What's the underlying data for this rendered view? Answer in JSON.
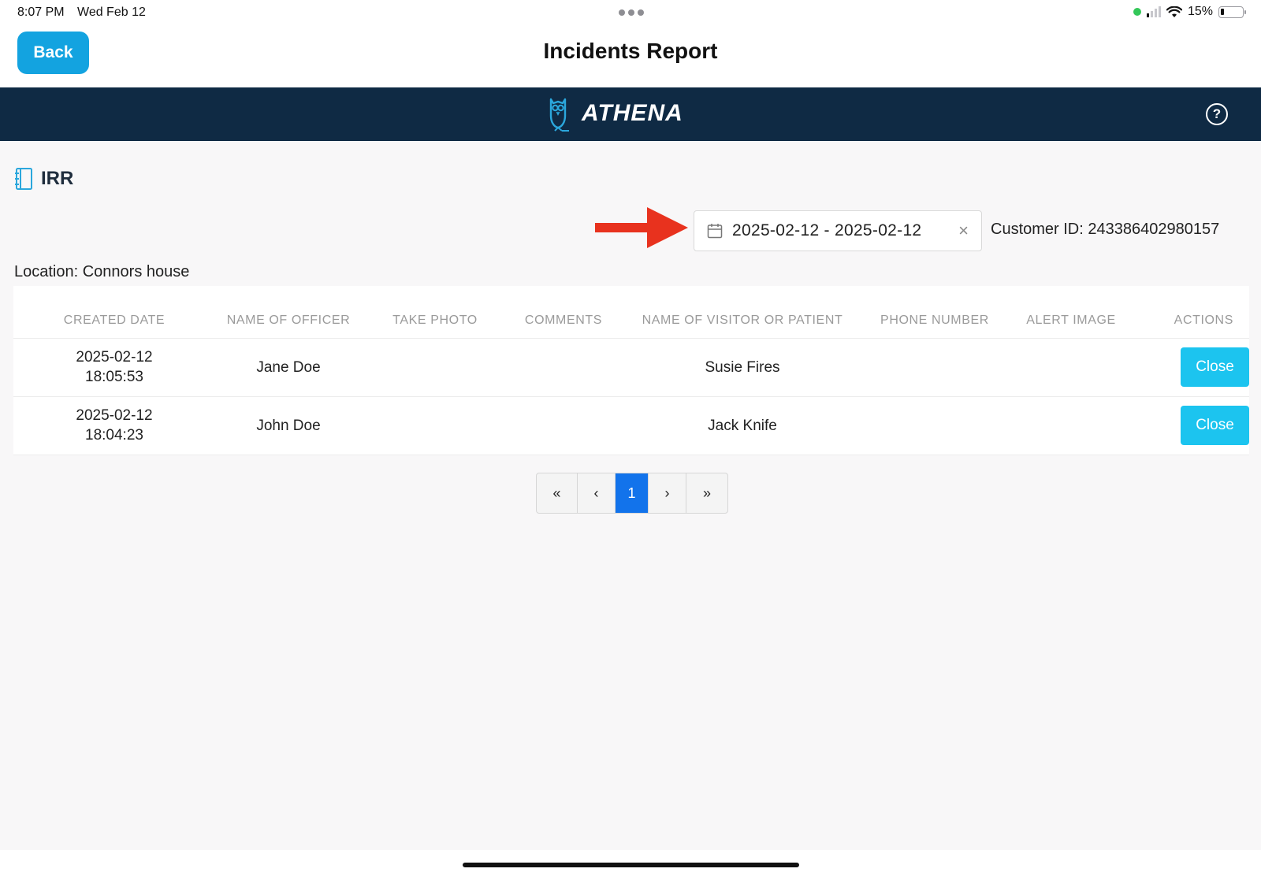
{
  "status_bar": {
    "time": "8:07 PM",
    "date": "Wed Feb 12",
    "battery_percent": "15%",
    "battery_level": 0.15,
    "icons": [
      "green-dot",
      "cellular-signal-icon",
      "wifi-icon",
      "battery-icon"
    ]
  },
  "nav": {
    "back_label": "Back",
    "title": "Incidents Report"
  },
  "brand": {
    "name": "ATHENA",
    "logo_icon": "owl-icon",
    "help_icon": "?",
    "bg_color": "#0f2a44"
  },
  "section": {
    "title": "IRR",
    "icon": "notebook-icon"
  },
  "filter": {
    "date_range": "2025-02-12 - 2025-02-12",
    "clear_icon": "×",
    "customer_id": "Customer ID: 243386402980157",
    "annotation": "red-arrow"
  },
  "location": "Location: Connors house",
  "table": {
    "headers": [
      "CREATED DATE",
      "NAME OF OFFICER",
      "TAKE PHOTO",
      "COMMENTS",
      "NAME OF VISITOR OR PATIENT",
      "PHONE NUMBER",
      "ALERT IMAGE",
      "ACTIONS"
    ],
    "rows": [
      {
        "date": "2025-02-12",
        "time": "18:05:53",
        "officer": "Jane Doe",
        "take_photo": "",
        "comments": "",
        "visitor": "Susie Fires",
        "phone": "",
        "alert_image": "",
        "action": "Close"
      },
      {
        "date": "2025-02-12",
        "time": "18:04:23",
        "officer": "John Doe",
        "take_photo": "",
        "comments": "",
        "visitor": "Jack Knife",
        "phone": "",
        "alert_image": "",
        "action": "Close"
      }
    ]
  },
  "pagination": {
    "first": "«",
    "prev": "‹",
    "current": "1",
    "next": "›",
    "last": "»"
  },
  "colors": {
    "primary_button": "#13a3e0",
    "close_button": "#1cc4ef",
    "active_page": "#1273eb",
    "annotation_arrow": "#e8321e"
  }
}
